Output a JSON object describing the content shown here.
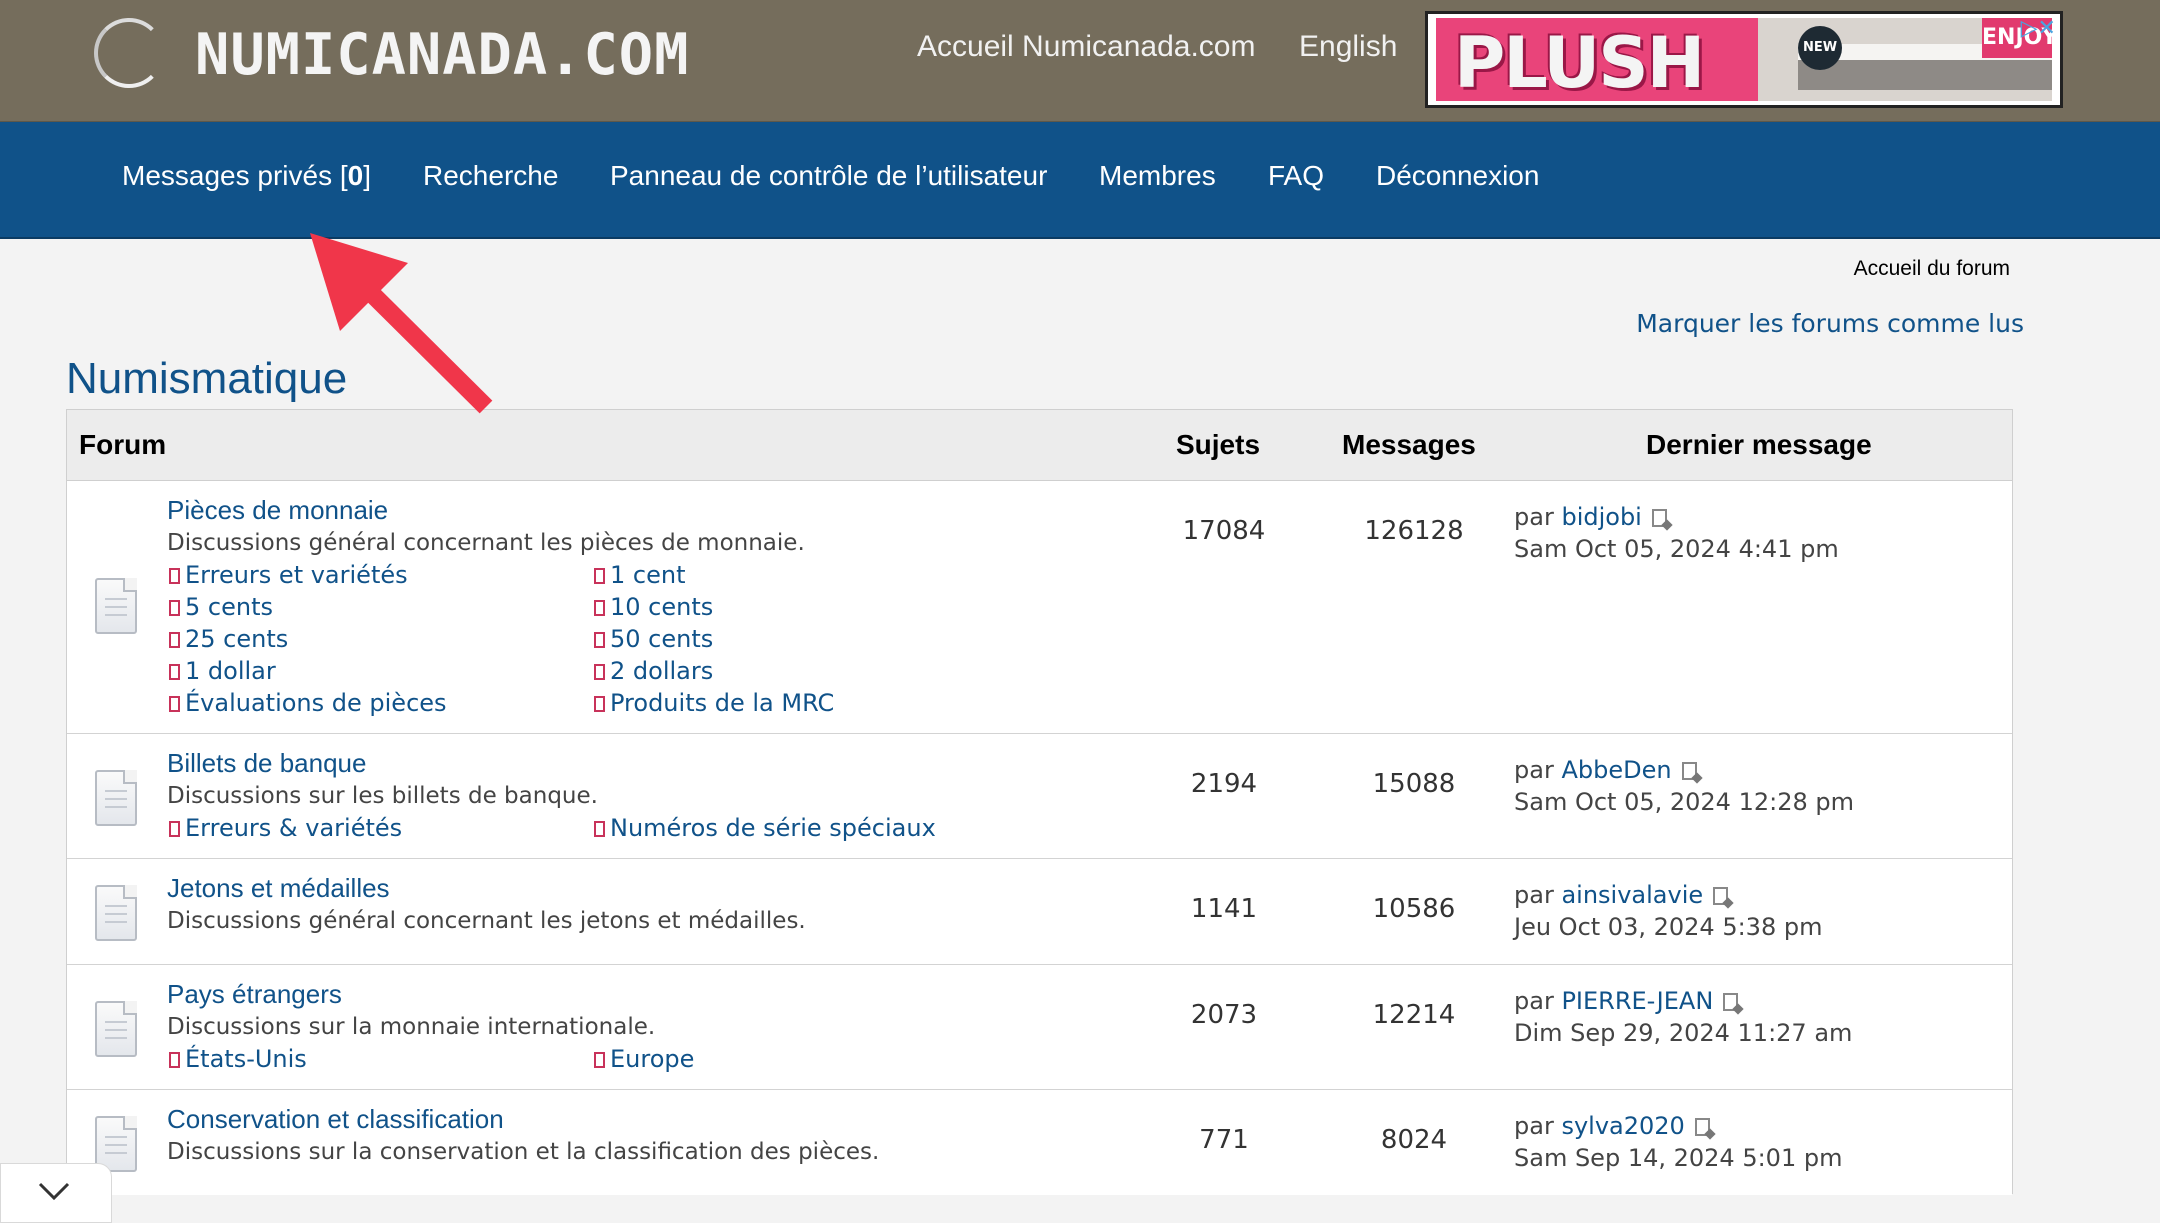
{
  "site": {
    "logo_text": "NUMICANADA.COM",
    "top_links": [
      "Accueil Numicanada.com",
      "English"
    ]
  },
  "ad": {
    "headline": "PLUSH",
    "badge": "NEW",
    "tag": "ENJOY"
  },
  "nav": {
    "items": [
      {
        "label": "Messages privés [",
        "count": "0",
        "suffix": "]"
      },
      {
        "label": "Recherche"
      },
      {
        "label": "Panneau de contrôle de l’utilisateur"
      },
      {
        "label": "Membres"
      },
      {
        "label": "FAQ"
      },
      {
        "label": "Déconnexion"
      }
    ]
  },
  "breadcrumb": "Accueil du forum",
  "mark_read": "Marquer les forums comme lus",
  "category": "Numismatique",
  "table": {
    "headers": {
      "forum": "Forum",
      "topics": "Sujets",
      "posts": "Messages",
      "last": "Dernier message"
    },
    "rows": [
      {
        "title": "Pièces de monnaie",
        "desc": "Discussions général concernant les pièces de monnaie.",
        "subforums": [
          "Erreurs et variétés",
          "1 cent",
          "5 cents",
          "10 cents",
          "25 cents",
          "50 cents",
          "1 dollar",
          "2 dollars",
          "Évaluations de pièces",
          "Produits de la MRC"
        ],
        "topics": "17084",
        "posts": "126128",
        "last_by": "par",
        "last_user": "bidjobi",
        "last_date": "Sam Oct 05, 2024 4:41 pm"
      },
      {
        "title": "Billets de banque",
        "desc": "Discussions sur les billets de banque.",
        "subforums": [
          "Erreurs & variétés",
          "Numéros de série spéciaux"
        ],
        "topics": "2194",
        "posts": "15088",
        "last_by": "par",
        "last_user": "AbbeDen",
        "last_date": "Sam Oct 05, 2024 12:28 pm"
      },
      {
        "title": "Jetons et médailles",
        "desc": "Discussions général concernant les jetons et médailles.",
        "subforums": [],
        "topics": "1141",
        "posts": "10586",
        "last_by": "par",
        "last_user": "ainsivalavie",
        "last_date": "Jeu Oct 03, 2024 5:38 pm"
      },
      {
        "title": "Pays étrangers",
        "desc": "Discussions sur la monnaie internationale.",
        "subforums": [
          "États-Unis",
          "Europe"
        ],
        "topics": "2073",
        "posts": "12214",
        "last_by": "par",
        "last_user": "PIERRE-JEAN",
        "last_date": "Dim Sep 29, 2024 11:27 am"
      },
      {
        "title": "Conservation et classification",
        "desc": "Discussions sur la conservation et la classification des pièces.",
        "subforums": [],
        "topics": "771",
        "posts": "8024",
        "last_by": "par",
        "last_user": "sylva2020",
        "last_date": "Sam Sep 14, 2024 5:01 pm"
      }
    ]
  },
  "colors": {
    "header_bg": "#756d5c",
    "nav_bg": "#105289",
    "link": "#105289",
    "arrow": "#f0364a"
  },
  "icons": [
    "forum-read-icon",
    "subforum-icon",
    "view-latest-post-icon",
    "annotation-arrow-icon",
    "chevron-down-icon"
  ]
}
